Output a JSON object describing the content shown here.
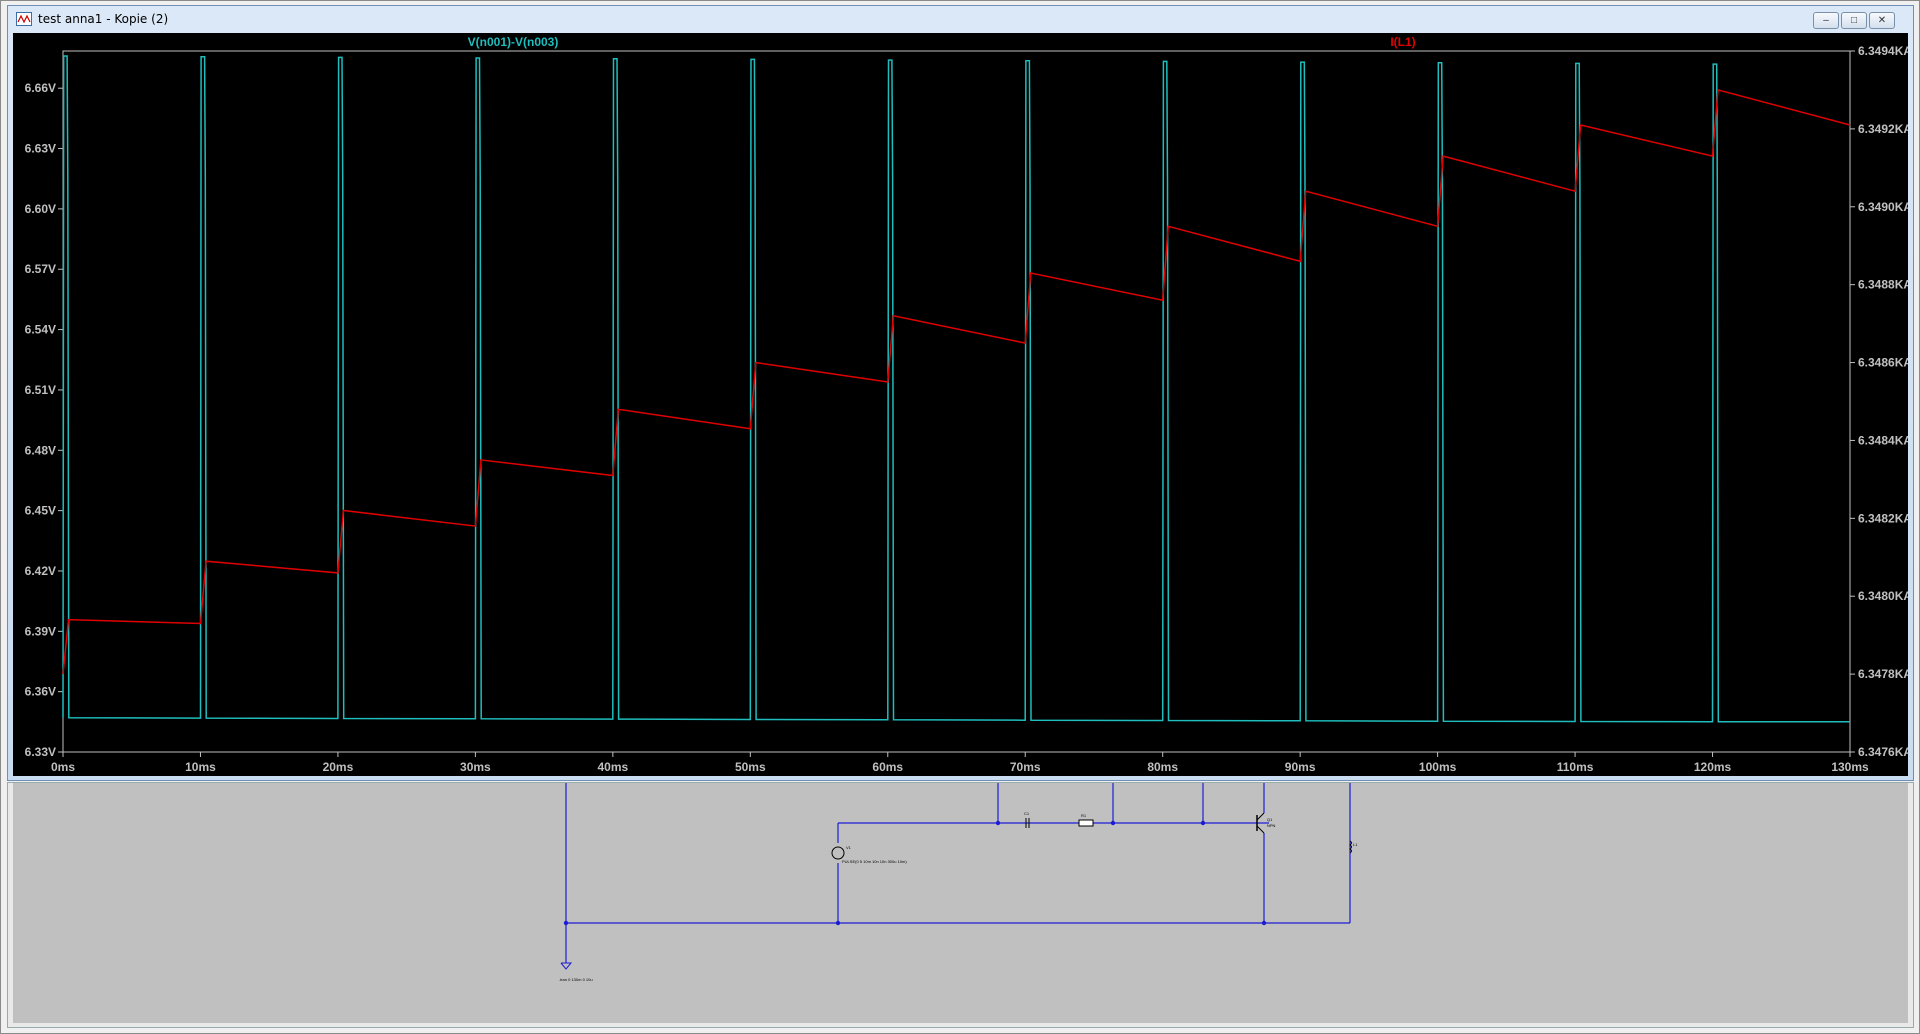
{
  "window": {
    "title": "test anna1 - Kopie (2)",
    "controls": {
      "minimize": "–",
      "maximize": "□",
      "close": "✕"
    }
  },
  "colors": {
    "background": "#000000",
    "trace_voltage": "#1fbdbd",
    "trace_current": "#e00000",
    "axis_text": "#c0c0c0",
    "schematic_bg": "#c0c0c0",
    "schematic_wire": "#1c1cd6"
  },
  "chart_data": {
    "type": "line",
    "grid": false,
    "xlabel": "",
    "x_ticks": [
      "0ms",
      "10ms",
      "20ms",
      "30ms",
      "40ms",
      "50ms",
      "60ms",
      "70ms",
      "80ms",
      "90ms",
      "100ms",
      "110ms",
      "120ms",
      "130ms"
    ],
    "xlim": [
      0,
      130
    ],
    "left_axis": {
      "ticks": [
        "6.33V",
        "6.36V",
        "6.39V",
        "6.42V",
        "6.45V",
        "6.48V",
        "6.51V",
        "6.54V",
        "6.57V",
        "6.60V",
        "6.63V",
        "6.66V"
      ],
      "ylim": [
        6.33,
        6.6785
      ]
    },
    "right_axis": {
      "ticks": [
        "6.3476KA",
        "6.3478KA",
        "6.3480KA",
        "6.3482KA",
        "6.3484KA",
        "6.3486KA",
        "6.3488KA",
        "6.3490KA",
        "6.3492KA",
        "6.3494KA"
      ],
      "ylim": [
        6347.6,
        6349.4
      ]
    },
    "series": [
      {
        "name": "V(n001)-V(n003)",
        "axis": "left",
        "period_ms": 10,
        "pulse_width_ms": 0.3,
        "high_start": 6.676,
        "high_end": 6.672,
        "low_start": 6.347,
        "low_end": 6.345
      },
      {
        "name": "I(L1)",
        "axis": "right",
        "x": [
          0,
          0.4,
          10,
          10.4,
          20,
          20.4,
          30,
          30.4,
          40,
          40.4,
          50,
          50.4,
          60,
          60.4,
          70,
          70.4,
          80,
          80.4,
          90,
          90.4,
          100,
          100.4,
          110,
          110.4,
          120,
          120.4,
          130
        ],
        "y": [
          6347.8,
          6347.94,
          6347.93,
          6348.09,
          6348.06,
          6348.22,
          6348.18,
          6348.35,
          6348.31,
          6348.48,
          6348.43,
          6348.6,
          6348.55,
          6348.72,
          6348.65,
          6348.83,
          6348.76,
          6348.95,
          6348.86,
          6349.04,
          6348.95,
          6349.13,
          6349.04,
          6349.21,
          6349.13,
          6349.3,
          6349.21
        ]
      }
    ]
  },
  "schematic": {
    "source_label": "V1",
    "source_value": "PULSE(0 5 10m 10n 10n 300u 10m)",
    "transistor_label": "Q1",
    "transistor_model": "NPN",
    "directive": ".tran 0 130m 0 10u",
    "component_labels": [
      "C1",
      "R1",
      "L1"
    ]
  }
}
